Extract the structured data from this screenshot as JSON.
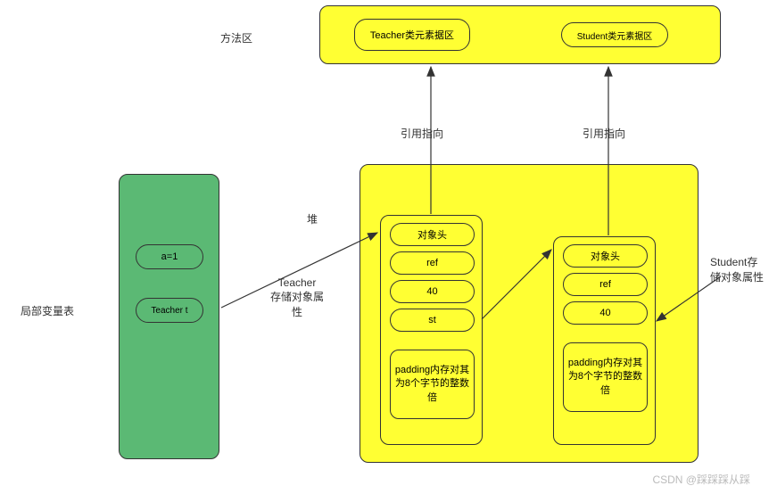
{
  "labels": {
    "method_area": "方法区",
    "heap": "堆",
    "local_var_table": "局部变量表",
    "ref_point_1": "引用指向",
    "ref_point_2": "引用指向",
    "teacher_store": "Teacher\n存储对象属性",
    "student_store": "Student存储对象属性"
  },
  "method_area": {
    "teacher_meta": "Teacher类元素据区",
    "student_meta": "Student类元素据区"
  },
  "local_vars": {
    "a": "a=1",
    "t": "Teacher t"
  },
  "teacher_obj": {
    "header": "对象头",
    "ref": "ref",
    "val": "40",
    "st": "st",
    "padding": "padding内存对其为8个字节的整数倍"
  },
  "student_obj": {
    "header": "对象头",
    "ref": "ref",
    "val": "40",
    "padding": "padding内存对其为8个字节的整数倍"
  },
  "watermark": "CSDN @踩踩踩从踩"
}
